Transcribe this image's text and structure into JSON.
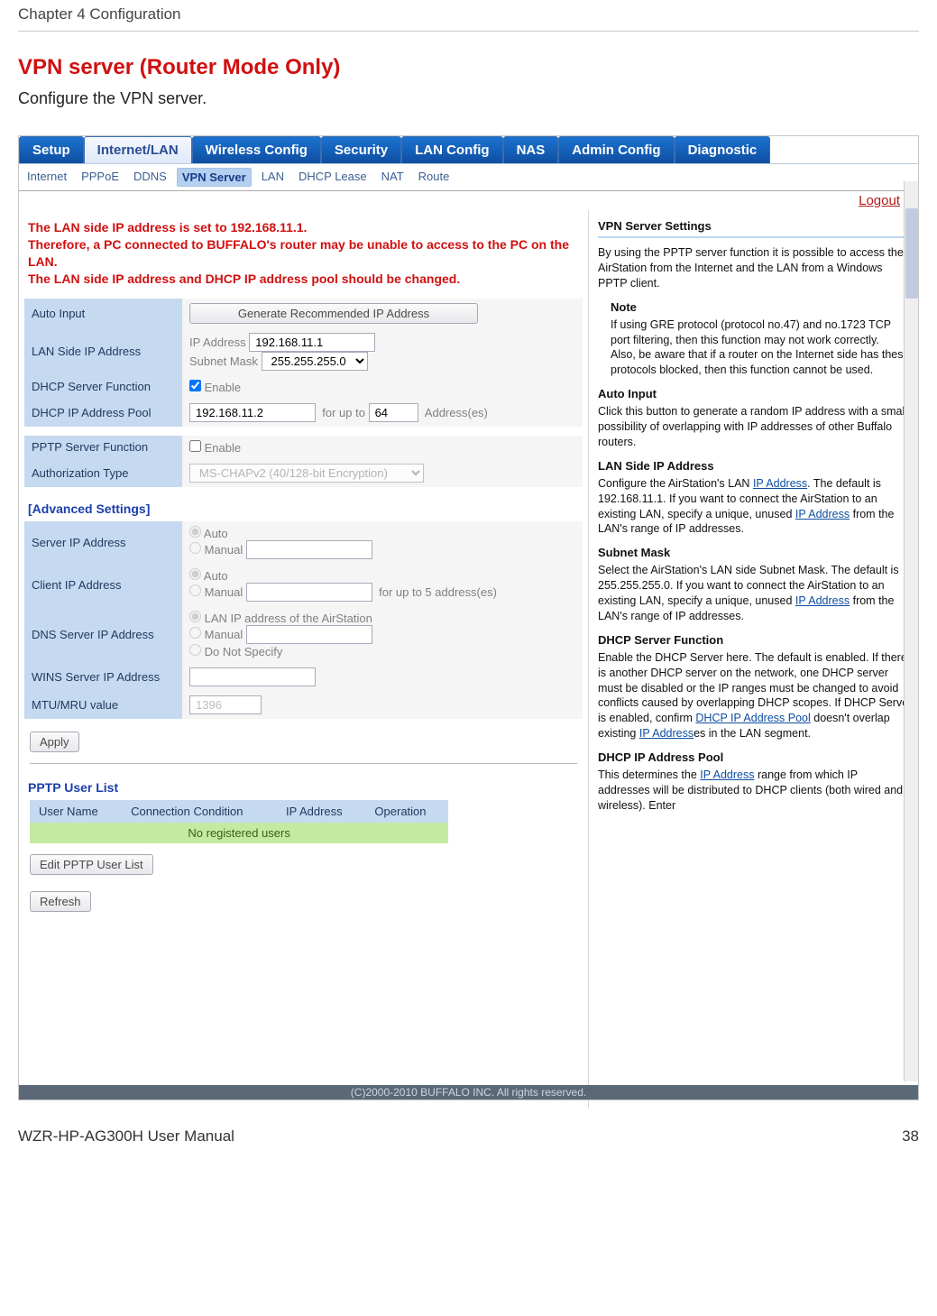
{
  "header": {
    "left": "Chapter 4  Configuration"
  },
  "title": "VPN server (Router Mode Only)",
  "intro": "Configure the VPN server.",
  "main_tabs": [
    "Setup",
    "Internet/LAN",
    "Wireless Config",
    "Security",
    "LAN Config",
    "NAS",
    "Admin Config",
    "Diagnostic"
  ],
  "sub_tabs": [
    "Internet",
    "PPPoE",
    "DDNS",
    "VPN Server",
    "LAN",
    "DHCP Lease",
    "NAT",
    "Route"
  ],
  "logout": "Logout",
  "warn": {
    "l1": "The LAN side IP address is set to 192.168.11.1.",
    "l2": "Therefore, a PC connected to BUFFALO's router may be unable to access to the PC on the LAN.",
    "l3": "The LAN side IP address and DHCP IP address pool should be changed."
  },
  "labels": {
    "auto_input": "Auto Input",
    "gen_btn": "Generate Recommended IP Address",
    "lan_ip": "LAN Side IP Address",
    "ip_addr": "IP Address",
    "subnet": "Subnet Mask",
    "dhcp_func": "DHCP Server Function",
    "enable": "Enable",
    "dhcp_pool": "DHCP IP Address Pool",
    "for_upto": "for up to",
    "addresses": "Address(es)",
    "pptp": "PPTP Server Function",
    "auth": "Authorization Type",
    "adv": "[Advanced Settings]",
    "srv_ip": "Server IP Address",
    "client_ip": "Client IP Address",
    "dns_ip": "DNS Server IP Address",
    "wins": "WINS Server IP Address",
    "mtu": "MTU/MRU value",
    "auto": "Auto",
    "manual": "Manual",
    "for5": "for up to 5 address(es)",
    "lan_air": "LAN IP address of the AirStation",
    "dont": "Do Not Specify",
    "apply": "Apply",
    "list_head": "PPTP User List",
    "col_user": "User Name",
    "col_cond": "Connection Condition",
    "col_ip": "IP Address",
    "col_op": "Operation",
    "noreg": "No registered users",
    "edit_list": "Edit PPTP User List",
    "refresh": "Refresh"
  },
  "values": {
    "ip": "192.168.11.1",
    "subnet": "255.255.255.0",
    "dhcp_start": "192.168.11.2",
    "dhcp_count": "64",
    "auth_sel": "MS-CHAPv2 (40/128-bit Encryption)",
    "mtu": "1396"
  },
  "help": {
    "h1": "VPN Server Settings",
    "p1": "By using the PPTP server function it is possible to access the AirStation from the Internet and the LAN from a Windows PPTP client.",
    "note_h": "Note",
    "note_p": "If using GRE protocol (protocol no.47) and no.1723 TCP port filtering, then this function may not work correctly.\nAlso, be aware that if a router on the Internet side has these protocols blocked, then this function cannot be used.",
    "h2": "Auto Input",
    "p2": "Click this button to generate a random IP address with a small possibility of overlapping with IP addresses of other Buffalo routers.",
    "h3": "LAN Side IP Address",
    "p3a": "Configure the AirStation's LAN ",
    "p3_link": "IP Address",
    "p3b": ". The default is 192.168.11.1. If you want to connect the AirStation to an existing LAN, specify a unique, unused ",
    "p3_link2": "IP Address",
    "p3c": " from the LAN's range of IP addresses.",
    "h4": "Subnet Mask",
    "p4a": "Select the AirStation's LAN side Subnet Mask. The default is 255.255.255.0. If you want to connect the AirStation to an existing LAN, specify a unique, unused ",
    "p4_link": "IP Address",
    "p4b": " from the LAN's range of IP addresses.",
    "h5": "DHCP  Server Function",
    "p5a": "Enable the DHCP Server here. The default is enabled. If there is another DHCP server on the network, one DHCP server must be disabled or the IP ranges must be changed to avoid conflicts caused by overlapping DHCP scopes. If DHCP Server is enabled, confirm ",
    "p5_link": "DHCP IP Address Pool",
    "p5b": " doesn't overlap existing ",
    "p5_link2": "IP Address",
    "p5c": "es in the LAN segment.",
    "h6": "DHCP IP Address Pool",
    "p6a": "This determines the ",
    "p6_link": "IP Address",
    "p6b": " range from which IP addresses will be distributed to DHCP clients (both wired and wireless). Enter"
  },
  "copyright": "(C)2000-2010 BUFFALO INC. All rights reserved.",
  "footer": {
    "left": "WZR-HP-AG300H User Manual",
    "right": "38"
  }
}
